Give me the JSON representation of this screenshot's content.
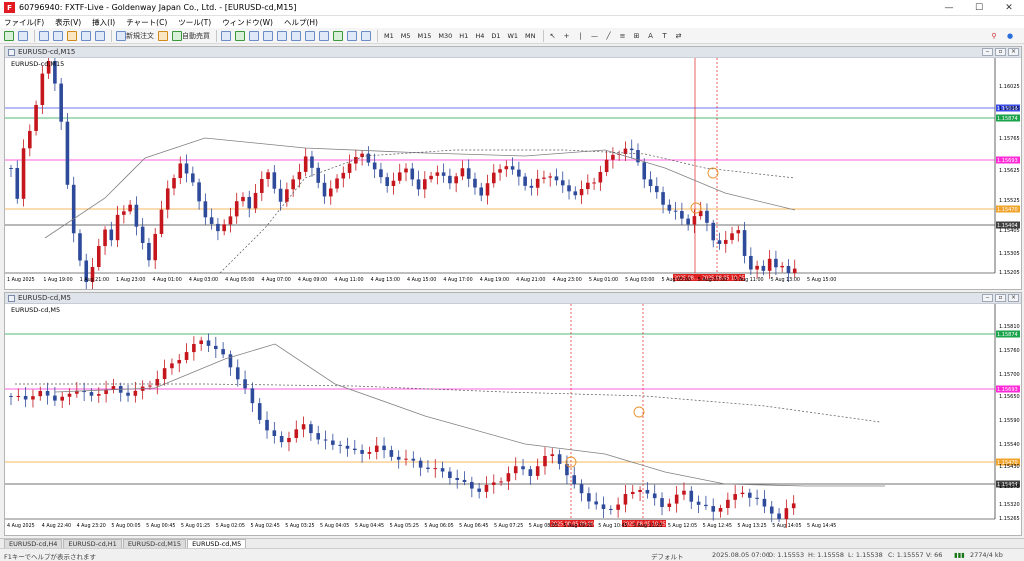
{
  "window": {
    "title": "60796940: FXTF-Live - Goldenway Japan Co., Ltd. - [EURUSD-cd,M15]",
    "icon_letter": "F"
  },
  "menu": [
    "ファイル(F)",
    "表示(V)",
    "挿入(I)",
    "チャート(C)",
    "ツール(T)",
    "ウィンドウ(W)",
    "ヘルプ(H)"
  ],
  "toolbar": {
    "new_order": "新規注文",
    "auto_trade": "自動売買",
    "timeframes": [
      "M1",
      "M5",
      "M15",
      "M30",
      "H1",
      "H4",
      "D1",
      "W1",
      "MN"
    ]
  },
  "charts": [
    {
      "window_title": "EURUSD-cd,M15",
      "symbol_label": "EURUSD-cd,M15",
      "x_labels": [
        "1 Aug 2025",
        "1 Aug 19:00",
        "1 Aug 21:00",
        "1 Aug 23:00",
        "4 Aug 01:00",
        "4 Aug 03:00",
        "4 Aug 05:00",
        "4 Aug 07:00",
        "4 Aug 09:00",
        "4 Aug 11:00",
        "4 Aug 13:00",
        "4 Aug 15:00",
        "4 Aug 17:00",
        "4 Aug 19:00",
        "4 Aug 21:00",
        "4 Aug 23:00",
        "5 Aug 01:00",
        "5 Aug 03:00",
        "5 Aug 05:00",
        "5 Aug 07:00",
        "5 Aug 11:00",
        "5 Aug 13:00",
        "5 Aug 15:00"
      ],
      "y_labels": [
        "1.16025",
        "1.15865",
        "1.15765",
        "1.15625",
        "1.15525",
        "1.15405",
        "1.15305",
        "1.15205"
      ],
      "vline_labels": [
        "2025.08...",
        "2025.08.05 10:25"
      ],
      "hlines": [
        {
          "label": "1.15918",
          "color": "#3b4ee8"
        },
        {
          "label": "1.15874",
          "color": "#1aa34a"
        },
        {
          "label": "1.15693",
          "color": "#ff2bd6"
        },
        {
          "label": "1.15470",
          "color": "#f2a32b"
        },
        {
          "label": "1.15404",
          "color": "#404040"
        }
      ]
    },
    {
      "window_title": "EURUSD-cd,M5",
      "symbol_label": "EURUSD-cd,M5",
      "x_labels": [
        "4 Aug 2025",
        "4 Aug 22:40",
        "4 Aug 23:20",
        "5 Aug 00:05",
        "5 Aug 00:45",
        "5 Aug 01:25",
        "5 Aug 02:05",
        "5 Aug 02:45",
        "5 Aug 03:25",
        "5 Aug 04:05",
        "5 Aug 04:45",
        "5 Aug 05:25",
        "5 Aug 06:05",
        "5 Aug 06:45",
        "5 Aug 07:25",
        "5 Aug 08:05",
        "5 Aug 09:25",
        "5 Aug 10:45",
        "5 Aug 11:25",
        "5 Aug 12:05",
        "5 Aug 12:45",
        "5 Aug 13:25",
        "5 Aug 14:05",
        "5 Aug 14:45"
      ],
      "y_labels": [
        "1.15810",
        "1.15760",
        "1.15700",
        "1.15650",
        "1.15590",
        "1.15540",
        "1.15430",
        "1.15375",
        "1.15320",
        "1.15265"
      ],
      "vline_labels": [
        "2025.08.05 09:00",
        "2025.08.05 10:25"
      ],
      "hlines": [
        {
          "label": "1.15874",
          "color": "#1aa34a"
        },
        {
          "label": "1.15693",
          "color": "#ff2bd6"
        },
        {
          "label": "1.15470",
          "color": "#f2a32b"
        },
        {
          "label": "1.15404",
          "color": "#404040"
        }
      ]
    }
  ],
  "tabs": [
    "EURUSD-cd,H4",
    "EURUSD-cd,H1",
    "EURUSD-cd,M15",
    "EURUSD-cd,M5"
  ],
  "active_tab": 3,
  "status": {
    "help": "F1キーでヘルプが表示されます",
    "profile": "デフォルト",
    "datetime": "2025.08.05 07:00",
    "open": "O: 1.15553",
    "high": "H: 1.15558",
    "low": "L: 1.15538",
    "close": "C: 1.15557",
    "volume": "V: 66",
    "traffic": "2774/4 kb"
  },
  "colors": {
    "bull": "#c4161c",
    "bear": "#2e4a9a",
    "ma": "#808080"
  }
}
